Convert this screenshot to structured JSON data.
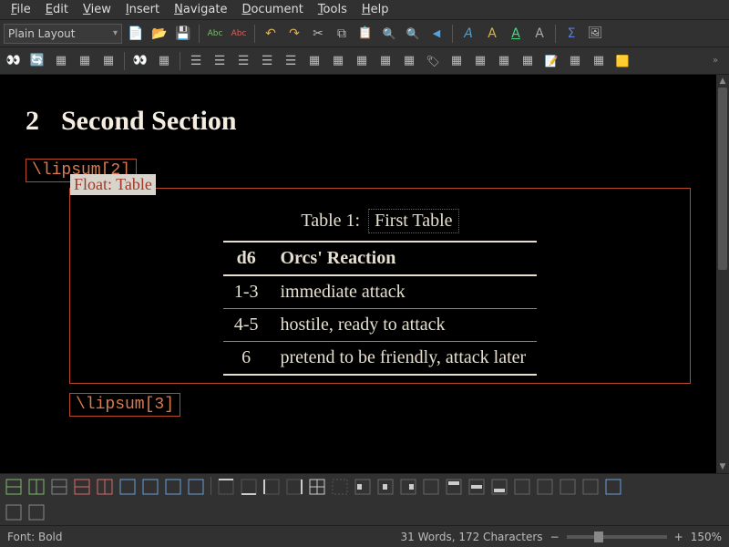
{
  "menu": {
    "file": "File",
    "edit": "Edit",
    "view": "View",
    "insert": "Insert",
    "navigate": "Navigate",
    "document": "Document",
    "tools": "Tools",
    "help": "Help"
  },
  "toolbar": {
    "layout_value": "Plain Layout"
  },
  "document": {
    "section_number": "2",
    "section_title": "Second Section",
    "lipsum_a": "\\lipsum[2]",
    "lipsum_b": "\\lipsum[3]",
    "float_label": "Float: Table",
    "caption_prefix": "Table 1:",
    "caption_text": "First Table",
    "table": {
      "headers": [
        "d6",
        "Orcs' Reaction"
      ],
      "rows": [
        [
          "1-3",
          "immediate attack"
        ],
        [
          "4-5",
          "hostile, ready to attack"
        ],
        [
          "6",
          "pretend to be friendly, attack later"
        ]
      ]
    }
  },
  "status": {
    "font": "Font: Bold",
    "wordcount": "31 Words, 172 Characters",
    "zoom_minus": "−",
    "zoom_plus": "+",
    "zoom_value": "150%"
  }
}
